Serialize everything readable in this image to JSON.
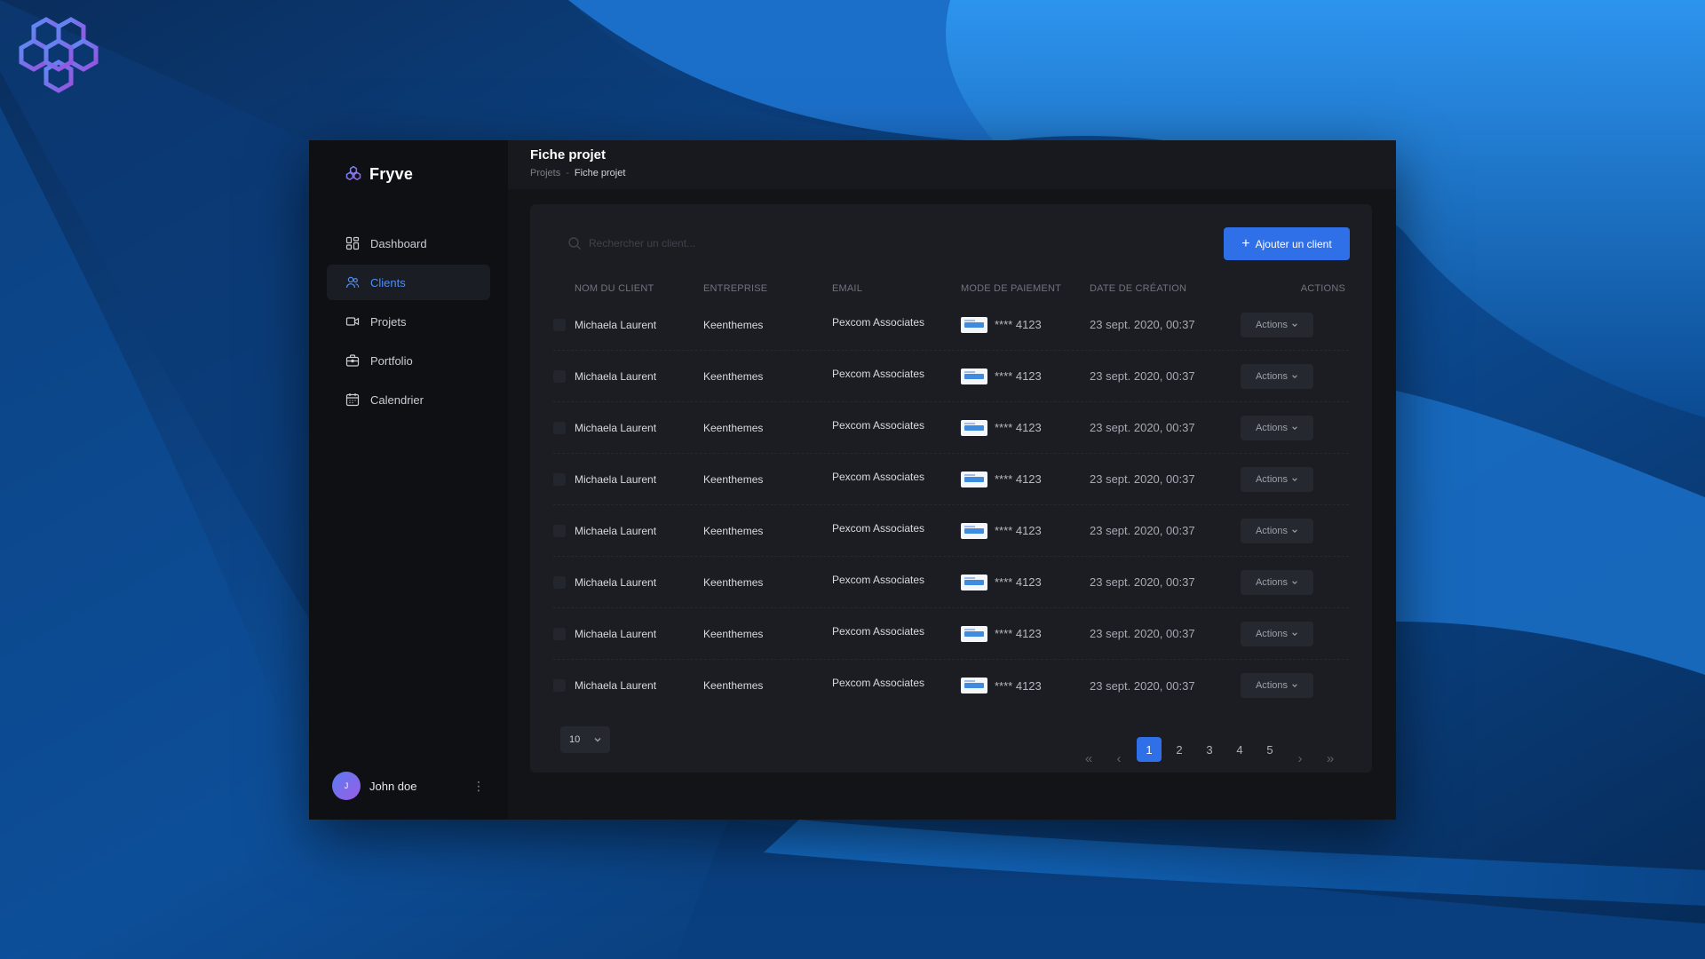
{
  "app": {
    "brand": "Fryve"
  },
  "sidebar": {
    "items": [
      {
        "label": "Dashboard",
        "icon": "dashboard-icon",
        "active": false
      },
      {
        "label": "Clients",
        "icon": "users-icon",
        "active": true
      },
      {
        "label": "Projets",
        "icon": "video-icon",
        "active": false
      },
      {
        "label": "Portfolio",
        "icon": "briefcase-icon",
        "active": false
      },
      {
        "label": "Calendrier",
        "icon": "calendar-icon",
        "active": false
      }
    ],
    "user": {
      "initial": "J",
      "name": "John doe",
      "menu": "⋮"
    }
  },
  "header": {
    "title": "Fiche projet",
    "breadcrumb": {
      "parent": "Projets",
      "separator": "-",
      "current": "Fiche projet"
    }
  },
  "search": {
    "placeholder": "Rechercher un client..."
  },
  "toolbar": {
    "add_label": "Ajouter un client",
    "add_icon": "plus-icon"
  },
  "table": {
    "columns": {
      "name": "NOM DU CLIENT",
      "company": "ENTREPRISE",
      "email": "EMAIL",
      "payment": "MODE DE PAIEMENT",
      "date": "DATE DE CRÉATION",
      "actions": "ACTIONS"
    },
    "rows": [
      {
        "name": "Michaela Laurent",
        "company": "Keenthemes",
        "email": "Pexcom Associates",
        "payment": "**** 4123",
        "date": "23 sept. 2020, 00:37",
        "action": "Actions"
      },
      {
        "name": "Michaela Laurent",
        "company": "Keenthemes",
        "email": "Pexcom Associates",
        "payment": "**** 4123",
        "date": "23 sept. 2020, 00:37",
        "action": "Actions"
      },
      {
        "name": "Michaela Laurent",
        "company": "Keenthemes",
        "email": "Pexcom Associates",
        "payment": "**** 4123",
        "date": "23 sept. 2020, 00:37",
        "action": "Actions"
      },
      {
        "name": "Michaela Laurent",
        "company": "Keenthemes",
        "email": "Pexcom Associates",
        "payment": "**** 4123",
        "date": "23 sept. 2020, 00:37",
        "action": "Actions"
      },
      {
        "name": "Michaela Laurent",
        "company": "Keenthemes",
        "email": "Pexcom Associates",
        "payment": "**** 4123",
        "date": "23 sept. 2020, 00:37",
        "action": "Actions"
      },
      {
        "name": "Michaela Laurent",
        "company": "Keenthemes",
        "email": "Pexcom Associates",
        "payment": "**** 4123",
        "date": "23 sept. 2020, 00:37",
        "action": "Actions"
      },
      {
        "name": "Michaela Laurent",
        "company": "Keenthemes",
        "email": "Pexcom Associates",
        "payment": "**** 4123",
        "date": "23 sept. 2020, 00:37",
        "action": "Actions"
      },
      {
        "name": "Michaela Laurent",
        "company": "Keenthemes",
        "email": "Pexcom Associates",
        "payment": "**** 4123",
        "date": "23 sept. 2020, 00:37",
        "action": "Actions"
      }
    ]
  },
  "pagination": {
    "page_size": "10",
    "pages": [
      "1",
      "2",
      "3",
      "4",
      "5"
    ],
    "current": "1",
    "first": "«",
    "prev": "‹",
    "next": "›",
    "last": "»"
  },
  "colors": {
    "accent": "#2f6fe8",
    "active_nav_text": "#4f8df7",
    "app_bg": "#131418",
    "sidebar_bg": "#0f1014",
    "card_bg": "#1c1d22"
  }
}
